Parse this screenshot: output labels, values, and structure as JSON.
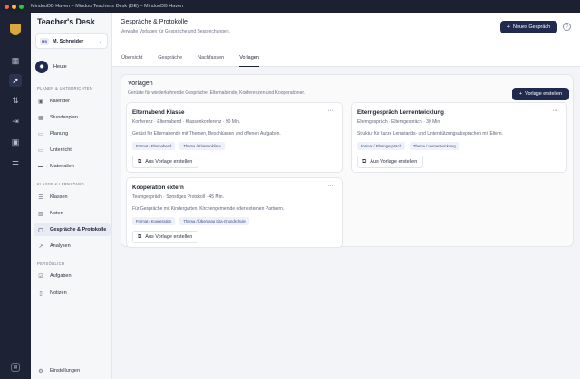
{
  "window": {
    "title": "MindooDB Haven – Mindoo Teacher's Desk (DE) – MindooDB Haven",
    "dots": [
      "#ff5f57",
      "#febc2e",
      "#28c840"
    ]
  },
  "rail": {
    "icons": [
      "dashboard-icon",
      "rocket-icon",
      "sort-icon",
      "split-icon",
      "id-card-icon",
      "sliders-icon"
    ],
    "bottom_icon": "panel-icon"
  },
  "sidebar": {
    "logo": "Teacher's Desk",
    "user": {
      "initials": "MS",
      "name": "M. Schneider"
    },
    "heute": "Heute",
    "sections": [
      {
        "label": "PLANEN & UNTERRICHTEN"
      },
      {
        "label": "KLASSE & LERNSTAND"
      },
      {
        "label": "PERSÖNLICH"
      }
    ],
    "items": [
      {
        "label": "Kalender",
        "icon": "calendar-icon"
      },
      {
        "label": "Stundenplan",
        "icon": "grid-icon"
      },
      {
        "label": "Planung",
        "icon": "doc-icon"
      },
      {
        "label": "Unterricht",
        "icon": "doc-icon"
      },
      {
        "label": "Materialien",
        "icon": "folder-icon"
      },
      {
        "label": "Klassen",
        "icon": "users-icon"
      },
      {
        "label": "Noten",
        "icon": "chart-icon"
      },
      {
        "label": "Gespräche & Protokolle",
        "icon": "chat-icon"
      },
      {
        "label": "Analysen",
        "icon": "trend-icon"
      },
      {
        "label": "Aufgaben",
        "icon": "check-icon"
      },
      {
        "label": "Notizen",
        "icon": "note-icon"
      }
    ],
    "settings": "Einstellungen"
  },
  "header": {
    "title": "Gespräche & Protokolle",
    "subtitle": "Verwalte Vorlagen für Gespräche und Besprechungen.",
    "new_button": "Neues Gespräch",
    "help": "?",
    "tabs": [
      "Übersicht",
      "Gespräche",
      "Nachfassen",
      "Vorlagen"
    ],
    "active_tab": "Vorlagen"
  },
  "panel": {
    "title": "Vorlagen",
    "subtitle": "Gerüste für wiederkehrende Gespräche, Elternabende, Konferenzen und Kooperationen.",
    "create_button": "Vorlage erstellen",
    "use_label": "Aus Vorlage erstellen",
    "more": "···",
    "cards": [
      {
        "title": "Elternabend Klasse",
        "meta": "Konferenz · Elternabend · Klassenkonferenz · 90 Min.",
        "desc": "Gerüst für Elternabende mit Themen, Beschlüssen und offenen Aufgaben.",
        "tags": [
          "Format / Elternabend",
          "Thema / Klassenklima"
        ]
      },
      {
        "title": "Elterngespräch Lernentwicklung",
        "meta": "Elterngespräch · Elterngespräch · 30 Min.",
        "desc": "Struktur für kurze Lernstands- und Unterstützungsabsprachen mit Eltern.",
        "tags": [
          "Format / Elterngespräch",
          "Thema / Lernentwicklung"
        ]
      },
      {
        "title": "Kooperation extern",
        "meta": "Teamgespräch · Sonstiges Protokoll · 45 Min.",
        "desc": "Für Gespräche mit Kindergarten, Kirchengemeinde oder externen Partnern.",
        "tags": [
          "Format / Kooperation",
          "Thema / Übergang Kita-Grundschule"
        ]
      }
    ]
  }
}
